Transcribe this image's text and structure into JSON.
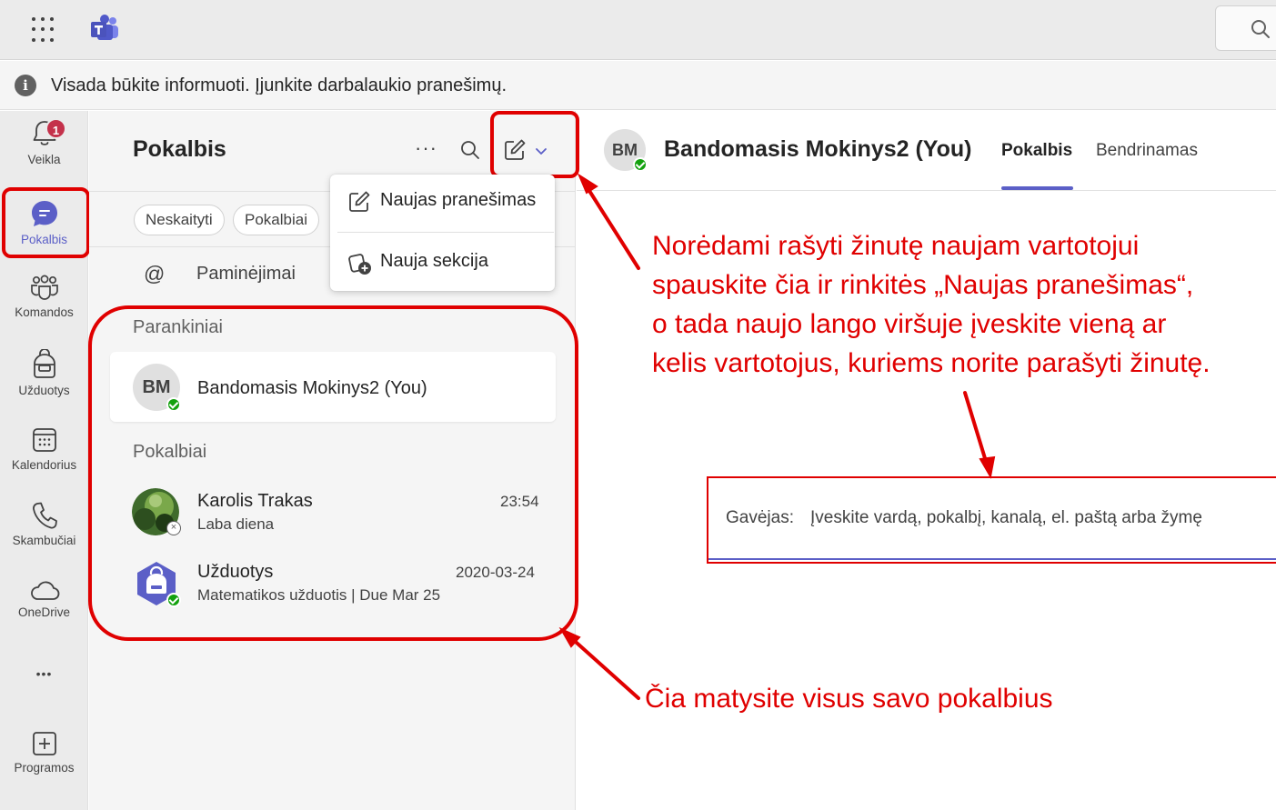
{
  "colors": {
    "accent": "#5b5fc7",
    "annotation": "#e00000",
    "badge": "#c4314b",
    "presence_available": "#13a10e"
  },
  "topbar": {
    "waffle_icon": "app-launcher-icon",
    "logo_icon": "teams-logo-icon",
    "search_icon": "search-icon"
  },
  "notification": {
    "icon": "info-icon",
    "text": "Visada būkite informuoti. Įjunkite darbalaukio pranešimų."
  },
  "rail": {
    "activity": {
      "label": "Veikla",
      "badge": "1",
      "icon": "bell-icon"
    },
    "chat": {
      "label": "Pokalbis",
      "icon": "chat-icon"
    },
    "teams": {
      "label": "Komandos",
      "icon": "teams-icon"
    },
    "assignments": {
      "label": "Užduotys",
      "icon": "backpack-icon"
    },
    "calendar": {
      "label": "Kalendorius",
      "icon": "calendar-icon"
    },
    "calls": {
      "label": "Skambučiai",
      "icon": "phone-icon"
    },
    "onedrive": {
      "label": "OneDrive",
      "icon": "cloud-icon"
    },
    "more": {
      "label": "•••",
      "icon": "more-icon"
    },
    "apps": {
      "label": "Programos",
      "icon": "plus-square-icon"
    }
  },
  "chat_panel": {
    "title": "Pokalbis",
    "more_label": "···",
    "filters": [
      "Neskaityti",
      "Pokalbiai"
    ],
    "mentions_symbol": "@",
    "mentions_label": "Paminėjimai",
    "pinned_section": "Parankiniai",
    "chats_section": "Pokalbiai",
    "pinned": {
      "initials": "BM",
      "name": "Bandomasis Mokinys2 (You)"
    },
    "chats": [
      {
        "name": "Karolis Trakas",
        "preview": "Laba diena",
        "time": "23:54",
        "presence": "offline"
      },
      {
        "name": "Užduotys",
        "preview": "Matematikos užduotis | Due Mar 25",
        "time": "2020-03-24",
        "presence": "available"
      }
    ]
  },
  "dropdown": {
    "items": [
      {
        "label": "Naujas pranešimas",
        "icon": "compose-icon"
      },
      {
        "label": "Nauja sekcija",
        "icon": "new-section-icon"
      }
    ]
  },
  "conversation": {
    "initials": "BM",
    "name": "Bandomasis Mokinys2 (You)",
    "tabs": [
      "Pokalbis",
      "Bendrinamas"
    ],
    "recipient_label": "Gavėjas:",
    "recipient_placeholder": "Įveskite vardą, pokalbį, kanalą, el. paštą arba žymę"
  },
  "annotations": {
    "top_lines": [
      "Norėdami rašyti žinutę naujam vartotojui",
      "spauskite čia ir rinkitės „Naujas pranešimas“,",
      "o tada naujo lango viršuje įveskite vieną ar",
      "kelis vartotojus, kuriems norite parašyti žinutę."
    ],
    "bottom": "Čia matysite visus savo pokalbius"
  }
}
